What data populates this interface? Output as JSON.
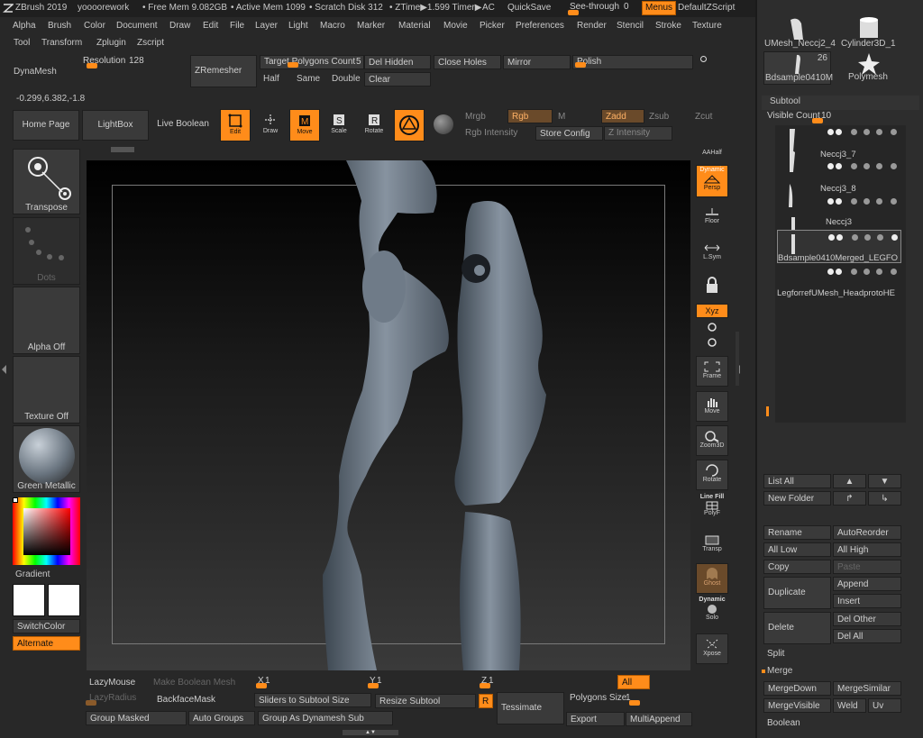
{
  "topbar": {
    "app_title": "ZBrush 2019",
    "doc_name": "yoooorework",
    "free_mem": "• Free Mem 9.082GB",
    "active_mem": "• Active Mem 1099",
    "scratch": "• Scratch Disk 312",
    "ztime": "• ZTime▶1.599 Timer▶",
    "ac": "AC",
    "quicksave": "QuickSave",
    "see_through": "See-through",
    "see_through_value": "0",
    "see_through_level": 0,
    "menus": "Menus",
    "default_zscript": "DefaultZScript"
  },
  "menubar": [
    "Alpha",
    "Brush",
    "Color",
    "Document",
    "Draw",
    "Edit",
    "File",
    "Layer",
    "Light",
    "Macro",
    "Marker",
    "Material",
    "Movie",
    "Picker",
    "Preferences",
    "Render",
    "Stencil",
    "Stroke",
    "Texture"
  ],
  "menubar2": [
    "Tool",
    "Transform",
    "Zplugin",
    "Zscript"
  ],
  "dynamesh": {
    "label": "DynaMesh",
    "resolution_label": "Resolution",
    "resolution_value": "128",
    "zremesher": "ZRemesher",
    "target_polygons_label": "Target Polygons Count",
    "target_polygons_value": "5",
    "half": "Half",
    "same": "Same",
    "double": "Double",
    "del_hidden": "Del Hidden",
    "clear": "Clear",
    "close_holes": "Close Holes",
    "mirror": "Mirror",
    "polish": "Polish"
  },
  "coords": "-0.299,6.382,-1.8",
  "toolbar": {
    "home_page": "Home Page",
    "lightbox": "LightBox",
    "live_boolean": "Live Boolean",
    "edit": "Edit",
    "draw": "Draw",
    "move": "Move",
    "scale": "Scale",
    "rotate": "Rotate",
    "mrgb": "Mrgb",
    "rgb": "Rgb",
    "m": "M",
    "rgb_intensity": "Rgb Intensity",
    "zadd": "Zadd",
    "zsub": "Zsub",
    "zcut": "Zcut",
    "store_config": "Store Config",
    "z_intensity": "Z Intensity"
  },
  "left_shelf": {
    "transpose": "Transpose",
    "dots": "Dots",
    "alpha_off": "Alpha Off",
    "texture_off": "Texture Off",
    "green_metallic": "Green Metallic",
    "gradient": "Gradient",
    "switch_color": "SwitchColor",
    "alternate": "Alternate"
  },
  "right_shelf": {
    "aahalf": "AAHalf",
    "dynamic": "Dynamic",
    "persp": "Persp",
    "floor": "Floor",
    "lsym": "L.Sym",
    "xyz": "Xyz",
    "frame": "Frame",
    "move": "Move",
    "zoom3d": "Zoom3D",
    "rotate": "Rotate",
    "line_fill": "Line Fill",
    "polyf": "PolyF",
    "transp": "Transp",
    "ghost": "Ghost",
    "dynamic2": "Dynamic",
    "solo": "Solo",
    "xpose": "Xpose"
  },
  "tool_thumbs": {
    "umesh": "UMesh_Neccj2_4",
    "cylinder": "Cylinder3D_1",
    "count": "26",
    "bdsample": "Bdsample0410M",
    "polymesh": "Polymesh"
  },
  "subtool": {
    "header": "Subtool",
    "visible_count_label": "Visible Count",
    "visible_count_value": "10",
    "items": [
      "",
      "Neccj3_7",
      "Neccj3_8",
      "Neccj3",
      "Bdsample0410Merged_LEGFO",
      "LegforrefUMesh_HeadprotoHE"
    ],
    "list_all": "List All",
    "new_folder": "New Folder",
    "rename": "Rename",
    "auto_reorder": "AutoReorder",
    "all_low": "All Low",
    "all_high": "All High",
    "copy": "Copy",
    "paste": "Paste",
    "duplicate": "Duplicate",
    "append": "Append",
    "insert": "Insert",
    "delete": "Delete",
    "del_other": "Del Other",
    "del_all": "Del All",
    "split": "Split",
    "merge": "Merge",
    "merge_down": "MergeDown",
    "merge_similar": "MergeSimilar",
    "merge_visible": "MergeVisible",
    "weld": "Weld",
    "uv": "Uv",
    "boolean": "Boolean"
  },
  "bottom": {
    "lazy_mouse": "LazyMouse",
    "make_boolean_mesh": "Make Boolean Mesh",
    "x_label": "X",
    "x_value": "1",
    "y_label": "Y",
    "y_value": "1",
    "z_label": "Z",
    "z_value": "1",
    "all": "All",
    "lazy_radius": "LazyRadius",
    "backface_mask": "BackfaceMask",
    "sliders_to_subtool_size": "Sliders to Subtool Size",
    "resize_subtool": "Resize Subtool",
    "r": "R",
    "tessimate": "Tessimate",
    "polygons_size_label": "Polygons Size",
    "polygons_size_value": "1",
    "group_masked": "Group Masked",
    "auto_groups": "Auto Groups",
    "group_as_dynamesh_sub": "Group As Dynamesh Sub",
    "export": "Export",
    "multi_append": "MultiAppend"
  },
  "colors": {
    "accent": "#ff8c1a",
    "panel": "#3a3a3a",
    "background": "#282828"
  }
}
